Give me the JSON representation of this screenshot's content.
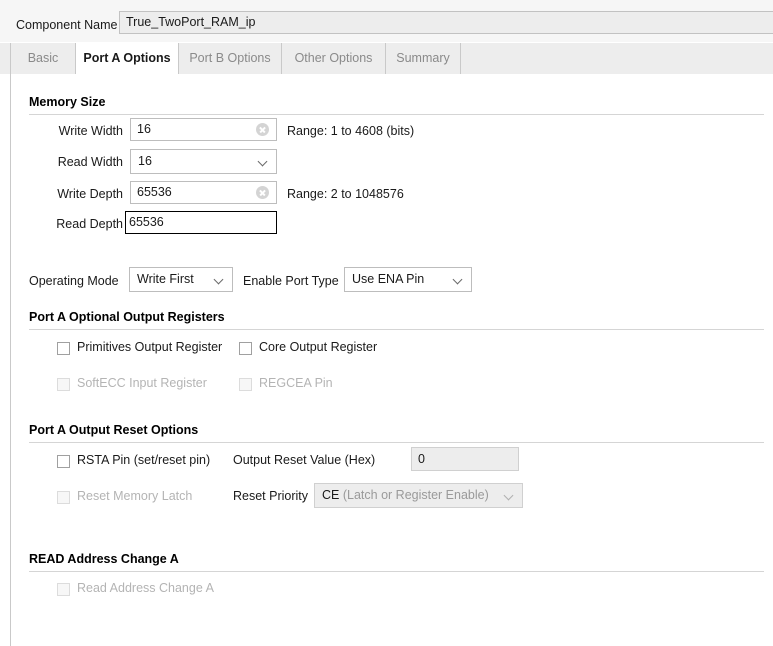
{
  "component": {
    "label": "Component Name",
    "value": "True_TwoPort_RAM_ip"
  },
  "tabs": [
    {
      "label": "Basic",
      "active": false
    },
    {
      "label": "Port A Options",
      "active": true
    },
    {
      "label": "Port B Options",
      "active": false
    },
    {
      "label": "Other Options",
      "active": false
    },
    {
      "label": "Summary",
      "active": false
    }
  ],
  "memory_size": {
    "title": "Memory Size",
    "write_width": {
      "label": "Write Width",
      "value": "16",
      "range": "Range: 1 to 4608 (bits)",
      "clear_icon": "clear-icon"
    },
    "read_width": {
      "label": "Read Width",
      "value": "16",
      "chevron_icon": "chevron-down-icon"
    },
    "write_depth": {
      "label": "Write Depth",
      "value": "65536",
      "range": "Range: 2 to 1048576",
      "clear_icon": "clear-icon"
    },
    "read_depth": {
      "label": "Read Depth",
      "value": "65536"
    }
  },
  "mode_row": {
    "operating_mode": {
      "label": "Operating Mode",
      "value": "Write First",
      "chevron_icon": "chevron-down-icon"
    },
    "enable_port_type": {
      "label": "Enable Port Type",
      "value": "Use ENA Pin",
      "chevron_icon": "chevron-down-icon"
    }
  },
  "optional_output_registers": {
    "title": "Port A Optional Output Registers",
    "checkboxes": [
      {
        "label": "Primitives Output Register",
        "checked": false,
        "disabled": false
      },
      {
        "label": "Core Output Register",
        "checked": false,
        "disabled": false
      },
      {
        "label": "SoftECC Input Register",
        "checked": false,
        "disabled": true
      },
      {
        "label": "REGCEA Pin",
        "checked": false,
        "disabled": true
      }
    ]
  },
  "output_reset_options": {
    "title": "Port A Output Reset Options",
    "rsta_pin": {
      "label": "RSTA Pin (set/reset pin)",
      "checked": false,
      "disabled": false
    },
    "reset_memory_latch": {
      "label": "Reset Memory Latch",
      "checked": false,
      "disabled": true
    },
    "output_reset_value": {
      "label": "Output Reset Value (Hex)",
      "value": "0"
    },
    "reset_priority": {
      "label": "Reset Priority",
      "value_strong": "CE",
      "value_muted": "(Latch or Register Enable)",
      "chevron_icon": "chevron-down-icon"
    }
  },
  "read_address_change": {
    "title": "READ Address Change A",
    "checkbox": {
      "label": "Read Address Change A",
      "checked": false,
      "disabled": true
    }
  }
}
